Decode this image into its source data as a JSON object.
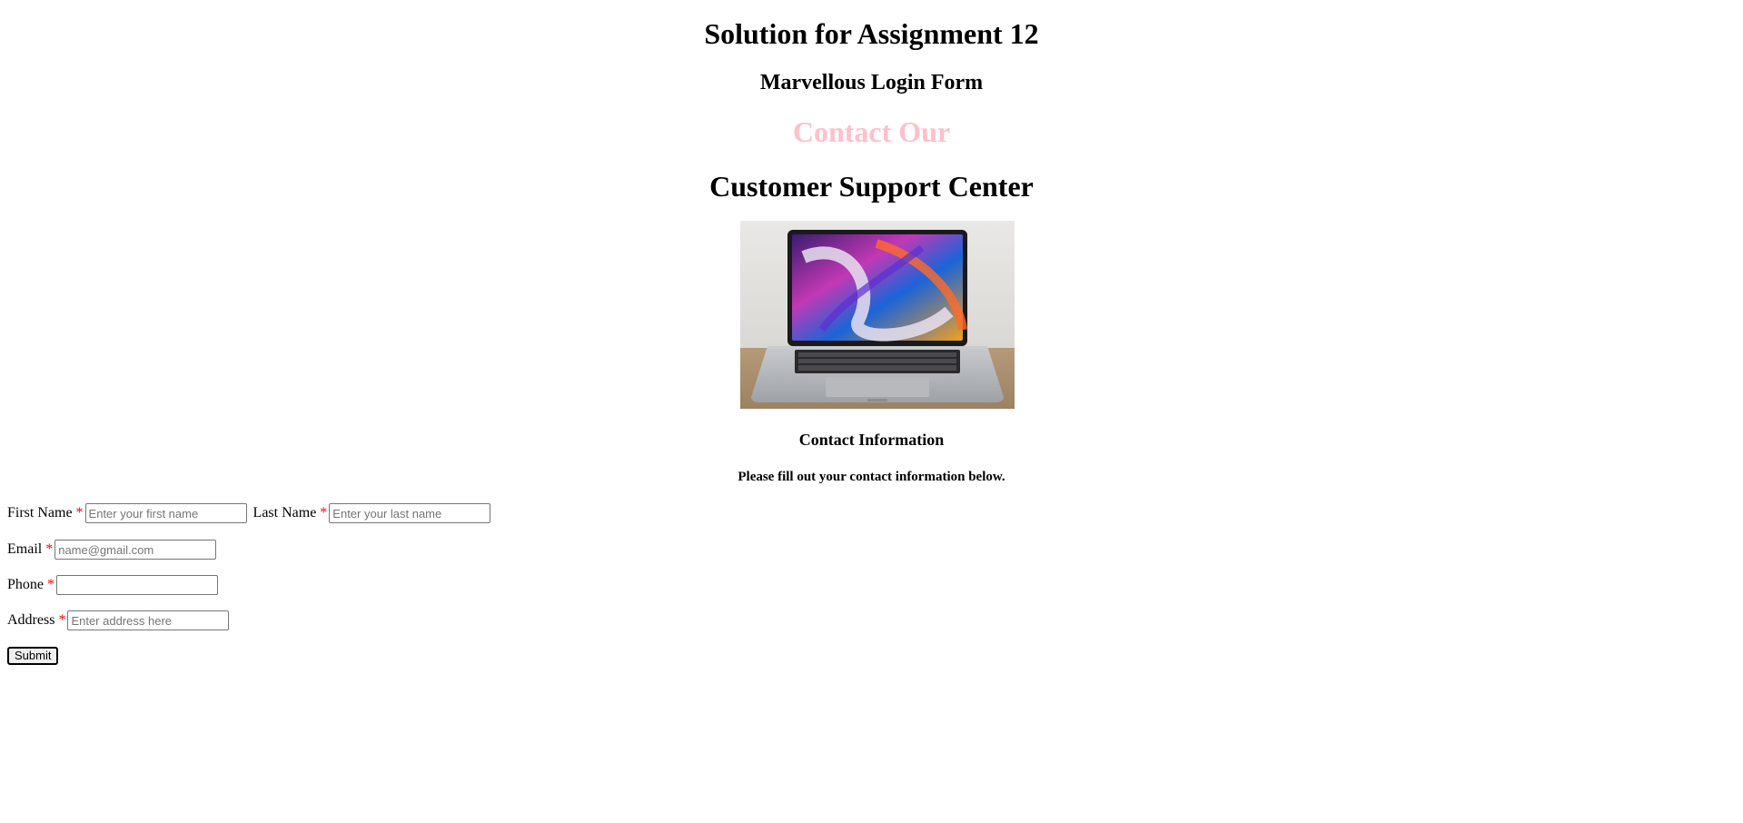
{
  "headings": {
    "title": "Solution for Assignment 12",
    "subtitle": "Marvellous Login Form",
    "contact_our": "Contact Our",
    "support_center": "Customer Support Center",
    "contact_info": "Contact Information",
    "instruction": "Please fill out your contact information below."
  },
  "form": {
    "first_name_label": "First Name",
    "first_name_placeholder": "Enter your first name",
    "last_name_label": "Last Name",
    "last_name_placeholder": "Enter your last name",
    "email_label": "Email",
    "email_placeholder": "name@gmail.com",
    "phone_label": "Phone",
    "phone_placeholder": "",
    "address_label": "Address",
    "address_placeholder": "Enter address here",
    "required_marker": "*",
    "submit_label": "Submit"
  },
  "colors": {
    "accent_pink": "#ffc0cb",
    "required_red": "#ff0000"
  },
  "image": {
    "subject": "laptop-photo"
  }
}
